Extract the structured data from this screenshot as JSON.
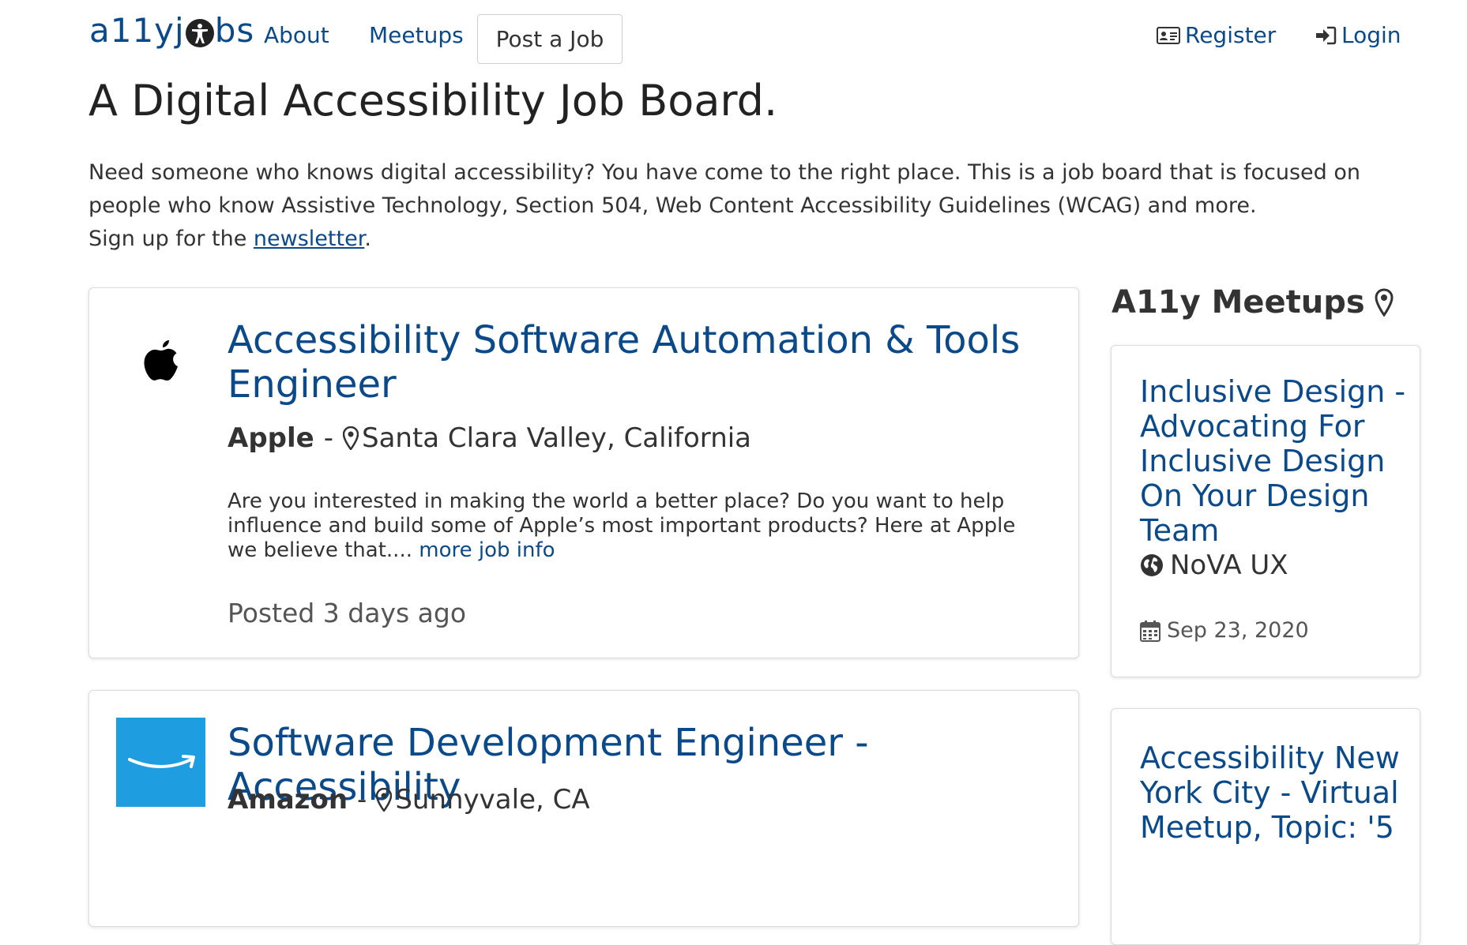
{
  "nav": {
    "logo_text_left": "a11yj",
    "logo_text_right": "bs",
    "about": "About",
    "meetups": "Meetups",
    "post_job": "Post a Job",
    "register": "Register",
    "login": "Login"
  },
  "hero": {
    "title": "A Digital Accessibility Job Board.",
    "line1": "Need someone who knows digital accessibility? You have come to the right place. This is a job board that is focused on people who know Assistive Technology, Section 504, Web Content Accessibility Guidelines (WCAG) and more.",
    "signup_prefix": "Sign up for the ",
    "newsletter_link": "newsletter",
    "signup_suffix": "."
  },
  "jobs": [
    {
      "title": "Accessibility Software Automation & Tools Engineer",
      "company": "Apple",
      "separator": "-",
      "location": "Santa Clara Valley, California",
      "description": "Are you interested in making the world a better place? Do you want to help influence and build some of Apple’s most important products? Here at Apple we believe that....",
      "more_link": "more job info",
      "posted": "Posted 3 days ago",
      "logo_icon": "apple-logo"
    },
    {
      "title": "Software Development Engineer - Accessibility",
      "company": "Amazon",
      "separator": "-",
      "location": "Sunnyvale, CA",
      "logo_icon": "amazon-logo"
    }
  ],
  "sidebar": {
    "title": "A11y Meetups",
    "meetups": [
      {
        "title": "Inclusive Design - Advocating For Inclusive Design On Your Design Team",
        "org": "NoVA UX",
        "date": "Sep 23, 2020"
      },
      {
        "title": "Accessibility New York City - Virtual Meetup, Topic: '5"
      }
    ]
  },
  "colors": {
    "link": "#0b4a8a",
    "text": "#333333",
    "amazon_bg": "#1e9ee0"
  }
}
